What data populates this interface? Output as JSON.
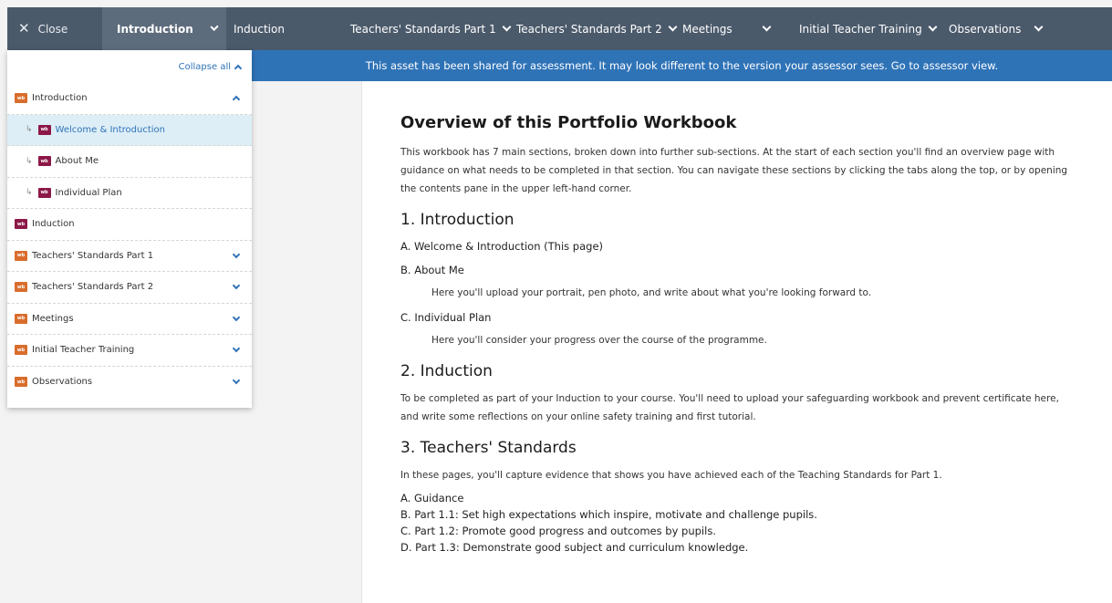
{
  "nav": {
    "close_label": "Close",
    "tabs": [
      {
        "label": "Introduction"
      },
      {
        "label": "Induction"
      },
      {
        "label": "Teachers' Standards Part 1"
      },
      {
        "label": "Teachers' Standards Part 2"
      },
      {
        "label": "Meetings"
      },
      {
        "label": "Initial Teacher Training"
      },
      {
        "label": "Observations"
      }
    ]
  },
  "banner": {
    "text": "This asset has been shared for assessment. It may look different to the version your assessor sees. Go to assessor view."
  },
  "sidebar": {
    "collapse_label": "Collapse all",
    "icon_text": "wb",
    "items": [
      {
        "label": "Introduction"
      },
      {
        "label": "Welcome & Introduction"
      },
      {
        "label": "About Me"
      },
      {
        "label": "Individual Plan"
      },
      {
        "label": "Induction"
      },
      {
        "label": "Teachers' Standards Part 1"
      },
      {
        "label": "Teachers' Standards Part 2"
      },
      {
        "label": "Meetings"
      },
      {
        "label": "Initial Teacher Training"
      },
      {
        "label": "Observations"
      }
    ]
  },
  "content": {
    "title": "Overview of this Portfolio Workbook",
    "intro": "This workbook has 7 main sections, broken down into further sub-sections. At the start of each section you'll find an overview page with guidance on what needs to be completed in that section. You can navigate these sections by clicking the tabs along the top, or by opening the contents pane in the upper left-hand corner.",
    "s1_heading": "1. Introduction",
    "s1_a": "A. Welcome & Introduction (This page)",
    "s1_b": "B. About Me",
    "s1_b_desc": "Here you'll upload your portrait, pen photo, and write about what you're looking forward to.",
    "s1_c": "C. Individual Plan",
    "s1_c_desc": "Here you'll consider your progress over the course of the programme.",
    "s2_heading": "2. Induction",
    "s2_body": "To be completed as part of your Induction to your course. You'll need to upload your safeguarding workbook and prevent certificate here, and write some reflections on your online safety training and first tutorial.",
    "s3_heading": "3. Teachers' Standards",
    "s3_body": "In these pages, you'll capture evidence that shows you have achieved each of the Teaching Standards for Part 1.",
    "s3_list": [
      "A. Guidance",
      "B. Part 1.1: Set high expectations which inspire, motivate and challenge pupils.",
      "C. Part 1.2: Promote good progress and outcomes by pupils.",
      "D. Part 1.3: Demonstrate good subject and curriculum knowledge."
    ]
  }
}
